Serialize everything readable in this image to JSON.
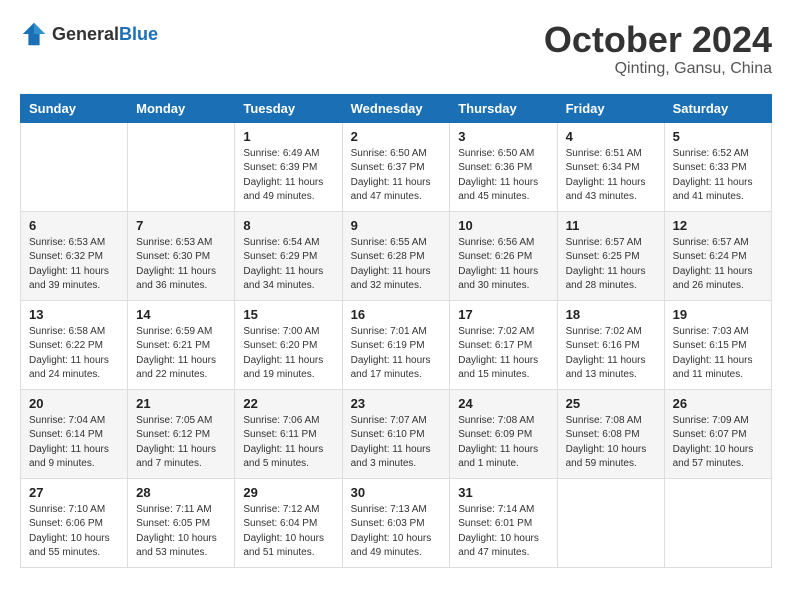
{
  "header": {
    "logo": {
      "general": "General",
      "blue": "Blue"
    },
    "month": "October 2024",
    "location": "Qinting, Gansu, China"
  },
  "weekdays": [
    "Sunday",
    "Monday",
    "Tuesday",
    "Wednesday",
    "Thursday",
    "Friday",
    "Saturday"
  ],
  "weeks": [
    [
      {
        "day": "",
        "sunrise": "",
        "sunset": "",
        "daylight": ""
      },
      {
        "day": "",
        "sunrise": "",
        "sunset": "",
        "daylight": ""
      },
      {
        "day": "1",
        "sunrise": "Sunrise: 6:49 AM",
        "sunset": "Sunset: 6:39 PM",
        "daylight": "Daylight: 11 hours and 49 minutes."
      },
      {
        "day": "2",
        "sunrise": "Sunrise: 6:50 AM",
        "sunset": "Sunset: 6:37 PM",
        "daylight": "Daylight: 11 hours and 47 minutes."
      },
      {
        "day": "3",
        "sunrise": "Sunrise: 6:50 AM",
        "sunset": "Sunset: 6:36 PM",
        "daylight": "Daylight: 11 hours and 45 minutes."
      },
      {
        "day": "4",
        "sunrise": "Sunrise: 6:51 AM",
        "sunset": "Sunset: 6:34 PM",
        "daylight": "Daylight: 11 hours and 43 minutes."
      },
      {
        "day": "5",
        "sunrise": "Sunrise: 6:52 AM",
        "sunset": "Sunset: 6:33 PM",
        "daylight": "Daylight: 11 hours and 41 minutes."
      }
    ],
    [
      {
        "day": "6",
        "sunrise": "Sunrise: 6:53 AM",
        "sunset": "Sunset: 6:32 PM",
        "daylight": "Daylight: 11 hours and 39 minutes."
      },
      {
        "day": "7",
        "sunrise": "Sunrise: 6:53 AM",
        "sunset": "Sunset: 6:30 PM",
        "daylight": "Daylight: 11 hours and 36 minutes."
      },
      {
        "day": "8",
        "sunrise": "Sunrise: 6:54 AM",
        "sunset": "Sunset: 6:29 PM",
        "daylight": "Daylight: 11 hours and 34 minutes."
      },
      {
        "day": "9",
        "sunrise": "Sunrise: 6:55 AM",
        "sunset": "Sunset: 6:28 PM",
        "daylight": "Daylight: 11 hours and 32 minutes."
      },
      {
        "day": "10",
        "sunrise": "Sunrise: 6:56 AM",
        "sunset": "Sunset: 6:26 PM",
        "daylight": "Daylight: 11 hours and 30 minutes."
      },
      {
        "day": "11",
        "sunrise": "Sunrise: 6:57 AM",
        "sunset": "Sunset: 6:25 PM",
        "daylight": "Daylight: 11 hours and 28 minutes."
      },
      {
        "day": "12",
        "sunrise": "Sunrise: 6:57 AM",
        "sunset": "Sunset: 6:24 PM",
        "daylight": "Daylight: 11 hours and 26 minutes."
      }
    ],
    [
      {
        "day": "13",
        "sunrise": "Sunrise: 6:58 AM",
        "sunset": "Sunset: 6:22 PM",
        "daylight": "Daylight: 11 hours and 24 minutes."
      },
      {
        "day": "14",
        "sunrise": "Sunrise: 6:59 AM",
        "sunset": "Sunset: 6:21 PM",
        "daylight": "Daylight: 11 hours and 22 minutes."
      },
      {
        "day": "15",
        "sunrise": "Sunrise: 7:00 AM",
        "sunset": "Sunset: 6:20 PM",
        "daylight": "Daylight: 11 hours and 19 minutes."
      },
      {
        "day": "16",
        "sunrise": "Sunrise: 7:01 AM",
        "sunset": "Sunset: 6:19 PM",
        "daylight": "Daylight: 11 hours and 17 minutes."
      },
      {
        "day": "17",
        "sunrise": "Sunrise: 7:02 AM",
        "sunset": "Sunset: 6:17 PM",
        "daylight": "Daylight: 11 hours and 15 minutes."
      },
      {
        "day": "18",
        "sunrise": "Sunrise: 7:02 AM",
        "sunset": "Sunset: 6:16 PM",
        "daylight": "Daylight: 11 hours and 13 minutes."
      },
      {
        "day": "19",
        "sunrise": "Sunrise: 7:03 AM",
        "sunset": "Sunset: 6:15 PM",
        "daylight": "Daylight: 11 hours and 11 minutes."
      }
    ],
    [
      {
        "day": "20",
        "sunrise": "Sunrise: 7:04 AM",
        "sunset": "Sunset: 6:14 PM",
        "daylight": "Daylight: 11 hours and 9 minutes."
      },
      {
        "day": "21",
        "sunrise": "Sunrise: 7:05 AM",
        "sunset": "Sunset: 6:12 PM",
        "daylight": "Daylight: 11 hours and 7 minutes."
      },
      {
        "day": "22",
        "sunrise": "Sunrise: 7:06 AM",
        "sunset": "Sunset: 6:11 PM",
        "daylight": "Daylight: 11 hours and 5 minutes."
      },
      {
        "day": "23",
        "sunrise": "Sunrise: 7:07 AM",
        "sunset": "Sunset: 6:10 PM",
        "daylight": "Daylight: 11 hours and 3 minutes."
      },
      {
        "day": "24",
        "sunrise": "Sunrise: 7:08 AM",
        "sunset": "Sunset: 6:09 PM",
        "daylight": "Daylight: 11 hours and 1 minute."
      },
      {
        "day": "25",
        "sunrise": "Sunrise: 7:08 AM",
        "sunset": "Sunset: 6:08 PM",
        "daylight": "Daylight: 10 hours and 59 minutes."
      },
      {
        "day": "26",
        "sunrise": "Sunrise: 7:09 AM",
        "sunset": "Sunset: 6:07 PM",
        "daylight": "Daylight: 10 hours and 57 minutes."
      }
    ],
    [
      {
        "day": "27",
        "sunrise": "Sunrise: 7:10 AM",
        "sunset": "Sunset: 6:06 PM",
        "daylight": "Daylight: 10 hours and 55 minutes."
      },
      {
        "day": "28",
        "sunrise": "Sunrise: 7:11 AM",
        "sunset": "Sunset: 6:05 PM",
        "daylight": "Daylight: 10 hours and 53 minutes."
      },
      {
        "day": "29",
        "sunrise": "Sunrise: 7:12 AM",
        "sunset": "Sunset: 6:04 PM",
        "daylight": "Daylight: 10 hours and 51 minutes."
      },
      {
        "day": "30",
        "sunrise": "Sunrise: 7:13 AM",
        "sunset": "Sunset: 6:03 PM",
        "daylight": "Daylight: 10 hours and 49 minutes."
      },
      {
        "day": "31",
        "sunrise": "Sunrise: 7:14 AM",
        "sunset": "Sunset: 6:01 PM",
        "daylight": "Daylight: 10 hours and 47 minutes."
      },
      {
        "day": "",
        "sunrise": "",
        "sunset": "",
        "daylight": ""
      },
      {
        "day": "",
        "sunrise": "",
        "sunset": "",
        "daylight": ""
      }
    ]
  ]
}
